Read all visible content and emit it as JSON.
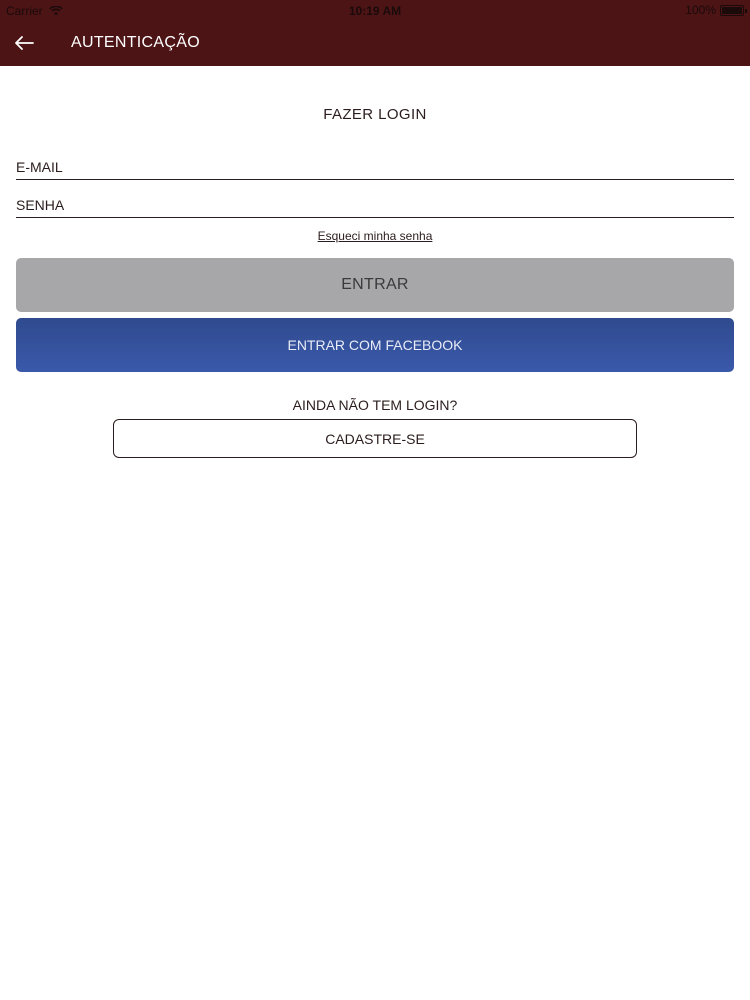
{
  "status_bar": {
    "carrier": "Carrier",
    "time": "10:19 AM",
    "battery": "100%"
  },
  "nav": {
    "back_icon": "arrow-left-icon",
    "title": "AUTENTICAÇÃO"
  },
  "login": {
    "heading": "FAZER LOGIN",
    "email_placeholder": "E-MAIL",
    "password_placeholder": "SENHA",
    "forgot_label": "Esqueci minha senha",
    "submit_label": "ENTRAR",
    "facebook_label": "ENTRAR COM FACEBOOK"
  },
  "register": {
    "prompt": "AINDA NÃO TEM LOGIN?",
    "button_label": "CADASTRE-SE"
  },
  "colors": {
    "header": "#4d1416",
    "entrar_button": "#a7a6a9",
    "facebook_button": "#3a59ab"
  }
}
